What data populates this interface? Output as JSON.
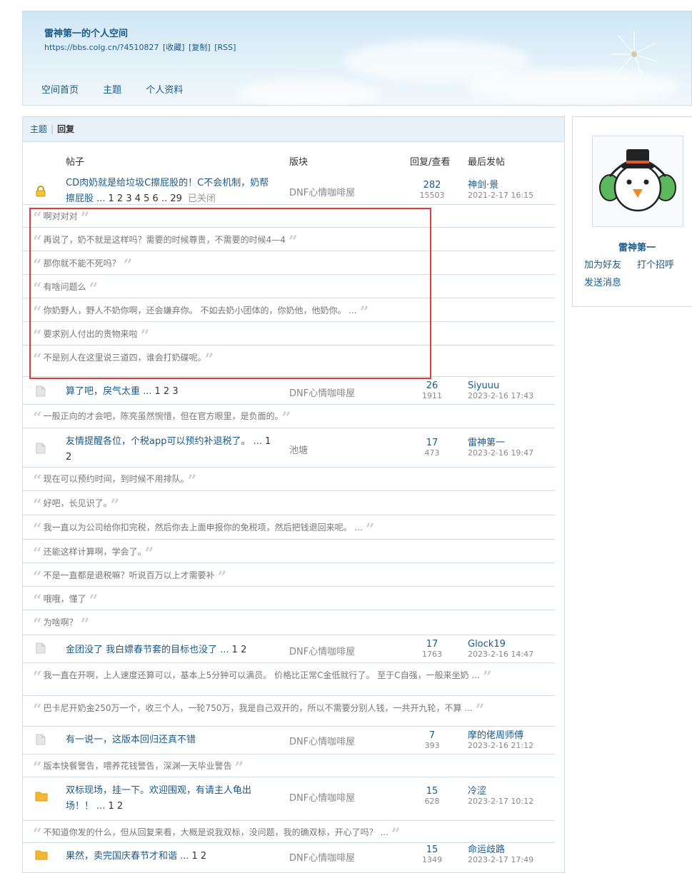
{
  "space": {
    "title": "雷神第一的个人空间",
    "url": "https://bbs.colg.cn/?4510827",
    "links": [
      "[收藏]",
      "[复制]",
      "[RSS]"
    ]
  },
  "nav": [
    "空间首页",
    "主题",
    "个人资料"
  ],
  "tabs": {
    "topics": "主题",
    "replies": "回复"
  },
  "table_header": {
    "post": "帖子",
    "forum": "版块",
    "reply_view": "回复/查看",
    "last_post": "最后发帖"
  },
  "rows": [
    {
      "type": "topic",
      "icon": "lock-icon",
      "title": "CD肉奶就是给垃圾C擦屁股的！C不会机制，奶帮擦屁股 ...",
      "pages": "1 2 3 4 5 6 .. 29",
      "status": "已关闭",
      "forum": "DNF心情咖啡屋",
      "replies": "282",
      "views": "15503",
      "last_user": "神剑·景",
      "last_time": "2021-2-17 16:15"
    },
    {
      "type": "quote",
      "text": "啊对对对"
    },
    {
      "type": "quote",
      "text": "再说了，奶不就是这样吗？需要的时候尊贵，不需要的时候4—4"
    },
    {
      "type": "quote",
      "text": "那你就不能不死吗？"
    },
    {
      "type": "quote",
      "text": "有啥问题么"
    },
    {
      "type": "quote",
      "text": "你奶野人，野人不奶你啊，还会嫌弃你。 不如去奶小团体的，你奶他，他奶你。 ..."
    },
    {
      "type": "quote",
      "text": "要求别人付出的贵物来啦"
    },
    {
      "type": "quote",
      "text": "不是别人在这里说三道四，谁会打奶碟呢。"
    },
    {
      "type": "topic",
      "icon": "document-icon",
      "title": "算了吧，戾气太重 ...",
      "pages": "1 2 3",
      "status": "",
      "forum": "DNF心情咖啡屋",
      "replies": "26",
      "views": "1911",
      "last_user": "Siyuuu",
      "last_time": "2023-2-16 17:43"
    },
    {
      "type": "quote",
      "text": "一般正向的才会吧，陈亮虽然惋惜，但在官方眼里，是负面的。"
    },
    {
      "type": "topic",
      "icon": "document-icon",
      "title": "友情提醒各位，个税app可以预约补退税了。 ...",
      "pages": "1 2",
      "status": "",
      "forum": "池塘",
      "replies": "17",
      "views": "473",
      "last_user": "雷神第一",
      "last_time": "2023-2-16 19:47"
    },
    {
      "type": "quote",
      "text": "现在可以预约时间，到时候不用排队。"
    },
    {
      "type": "quote",
      "text": "好吧，长见识了。"
    },
    {
      "type": "quote",
      "text": "我一直以为公司给你扣完税，然后你去上面申报你的免税项，然后把钱退回来呢。 ..."
    },
    {
      "type": "quote",
      "text": "还能这样计算啊，学会了。"
    },
    {
      "type": "quote",
      "text": "不是一直都是退税嘛？听说百万以上才需要补"
    },
    {
      "type": "quote",
      "text": "哦哦，懂了"
    },
    {
      "type": "quote",
      "text": "为啥啊？"
    },
    {
      "type": "topic",
      "icon": "document-icon",
      "title": "金团没了 我白嫖春节套的目标也没了 ...",
      "pages": "1 2",
      "status": "",
      "forum": "DNF心情咖啡屋",
      "replies": "17",
      "views": "1763",
      "last_user": "Glock19",
      "last_time": "2023-2-16 14:47"
    },
    {
      "type": "quote",
      "text": "我一直在开啊，上人速度还算可以，基本上5分钟可以满员。 价格比正常C金低就行了。 至于C自强，一般来坐奶 ..."
    },
    {
      "type": "quote",
      "text": "巴卡尼开奶金250万一个，收三个人，一轮750万，我是自己双开的，所以不需要分别人钱，一共开九轮，不算 ..."
    },
    {
      "type": "topic",
      "icon": "document-icon",
      "title": "有一说一，这版本回归还真不错",
      "pages": "",
      "status": "",
      "forum": "DNF心情咖啡屋",
      "replies": "7",
      "views": "393",
      "last_user": "摩的佬周师傅",
      "last_time": "2023-2-16 21:12"
    },
    {
      "type": "quote",
      "text": "版本快餐警告，喂养花钱警告，深渊一天毕业警告"
    },
    {
      "type": "topic",
      "icon": "folder-hot-icon",
      "title": "双标现场，挂一下。欢迎围观，有请主人龟出场！！ ...",
      "pages": "1 2",
      "status": "",
      "forum": "DNF心情咖啡屋",
      "replies": "15",
      "views": "628",
      "last_user": "冷涩",
      "last_time": "2023-2-17 10:12"
    },
    {
      "type": "quote",
      "text": "不知道你发的什么，但从回复来看，大概是说我双标，没问题，我的确双标，开心了吗？ ..."
    },
    {
      "type": "topic",
      "icon": "folder-hot-icon",
      "title": "果然，卖完国庆春节才和谐 ...",
      "pages": "1 2",
      "status": "",
      "forum": "DNF心情咖啡屋",
      "replies": "15",
      "views": "1349",
      "last_user": "命运歧路",
      "last_time": "2023-2-17 17:49"
    }
  ],
  "sidebar": {
    "name": "雷神第一",
    "add_friend": "加为好友",
    "greet": "打个招呼",
    "message": "发送消息"
  },
  "colors": {
    "link": "#1a5a8a",
    "highlight_box": "#e03c3c",
    "border": "#cfdde8"
  }
}
